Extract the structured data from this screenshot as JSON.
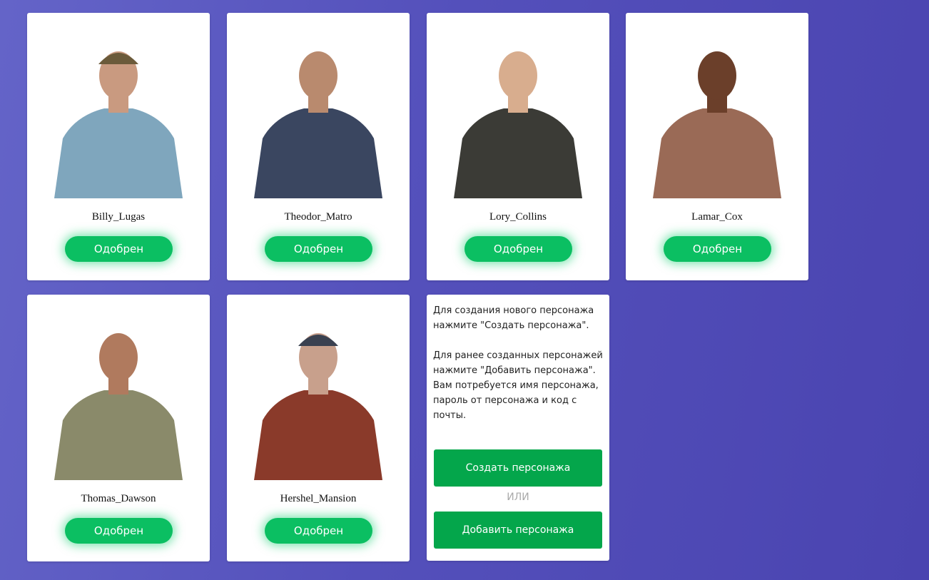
{
  "characters": [
    {
      "name": "Billy_Lugas",
      "status": "Одобрен",
      "shirt": "#7fa6bd",
      "skin": "#c99a80",
      "hat": "#6b5a3a"
    },
    {
      "name": "Theodor_Matro",
      "status": "Одобрен",
      "shirt": "#3a4660",
      "skin": "#b98a6e",
      "hat": ""
    },
    {
      "name": "Lory_Collins",
      "status": "Одобрен",
      "shirt": "#3b3b36",
      "skin": "#d8ad8e",
      "hat": ""
    },
    {
      "name": "Lamar_Cox",
      "status": "Одобрен",
      "shirt": "#9a6a56",
      "skin": "#6b3f2a",
      "hat": ""
    },
    {
      "name": "Thomas_Dawson",
      "status": "Одобрен",
      "shirt": "#8a8a6a",
      "skin": "#b07a5e",
      "hat": ""
    },
    {
      "name": "Hershel_Mansion",
      "status": "Одобрен",
      "shirt": "#8a3a2a",
      "skin": "#c8a08c",
      "hat": "#3a4150"
    }
  ],
  "info": {
    "paragraph1": "Для создания нового персонажа нажмите \"Создать персонажа\".",
    "paragraph2": "Для ранее созданных персонажей нажмите \"Добавить персонажа\". Вам потребуется имя персонажа, пароль от персонажа и код с почты.",
    "create_button": "Создать персонажа",
    "or_text": "ИЛИ",
    "add_button": "Добавить персонажа"
  },
  "colors": {
    "status_button": "#0bbf62",
    "action_button": "#04a64b"
  }
}
